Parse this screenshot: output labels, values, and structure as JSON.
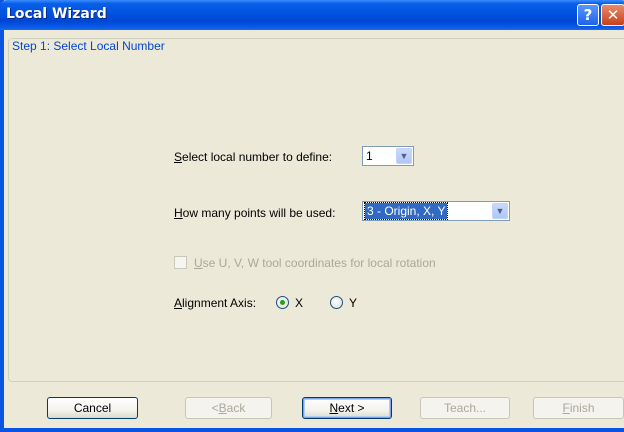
{
  "window": {
    "title": "Local Wizard",
    "help_glyph": "?",
    "close_glyph": "✕"
  },
  "step": {
    "legend": "Step 1: Select Local Number"
  },
  "local_number": {
    "label_mnemonic": "S",
    "label_rest": "elect local number to define:",
    "value": "1"
  },
  "points": {
    "label_mnemonic": "H",
    "label_rest": "ow many points will be used:",
    "value": "3 - Origin, X, Y"
  },
  "tool_coords": {
    "label_mnemonic": "U",
    "label_rest": "se U, V, W tool coordinates for local rotation",
    "checked": false,
    "enabled": false
  },
  "alignment": {
    "label_mnemonic": "A",
    "label_rest": "lignment Axis:",
    "options": [
      "X",
      "Y"
    ],
    "selected": "X"
  },
  "buttons": {
    "cancel": "Cancel",
    "back_prefix": "< ",
    "back_mnemonic": "B",
    "back_rest": "ack",
    "next_mnemonic": "N",
    "next_rest": "ext >",
    "teach": "Teach...",
    "finish_mnemonic": "F",
    "finish_rest": "inish"
  },
  "icons": {
    "dropdown": "chevron-down-icon",
    "help": "help-icon",
    "close": "close-icon"
  },
  "colors": {
    "titlebar": "#0054e3",
    "dialog_bg": "#ece9d8",
    "legend_text": "#0046d5",
    "selection": "#316ac5",
    "radio_dot": "#21a121"
  }
}
